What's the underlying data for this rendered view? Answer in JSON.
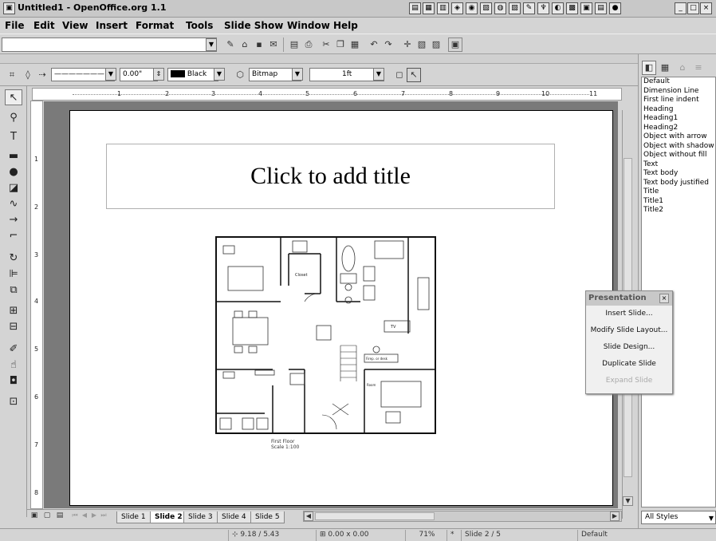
{
  "window": {
    "title": "Untitled1 - OpenOffice.org 1.1"
  },
  "menu": {
    "items": [
      "File",
      "Edit",
      "View",
      "Insert",
      "Format",
      "Tools",
      "Slide Show",
      "Window",
      "Help"
    ]
  },
  "object_bar": {
    "line_width": "0.00\"",
    "line_color": "Black",
    "area_style": "Bitmap",
    "area_fill": "1ft"
  },
  "ruler": {
    "h_numbers": [
      "1",
      "2",
      "3",
      "4",
      "5",
      "6",
      "7",
      "8",
      "9",
      "10",
      "11"
    ],
    "v_numbers": [
      "1",
      "2",
      "3",
      "4",
      "5",
      "6",
      "7",
      "8"
    ]
  },
  "slide": {
    "title_placeholder": "Click to add title",
    "plan_labels": {
      "closet": "Closet",
      "tv": "TV",
      "fireplace": "Firep. or desk",
      "room": "Room",
      "caption": "First Floor\nScale 1:100"
    }
  },
  "presentation_popup": {
    "title": "Presentation",
    "items": [
      {
        "label": "Insert Slide...",
        "enabled": true
      },
      {
        "label": "Modify Slide Layout...",
        "enabled": true
      },
      {
        "label": "Slide Design...",
        "enabled": true
      },
      {
        "label": "Duplicate Slide",
        "enabled": true
      },
      {
        "label": "Expand Slide",
        "enabled": false
      }
    ]
  },
  "stylist": {
    "styles": [
      "Default",
      "Dimension Line",
      "First line indent",
      "Heading",
      "Heading1",
      "Heading2",
      "Object with arrow",
      "Object with shadow",
      "Object without fill",
      "Text",
      "Text body",
      "Text body justified",
      "Title",
      "Title1",
      "Title2"
    ],
    "filter": "All Styles"
  },
  "tabs": [
    {
      "label": "Slide 1",
      "active": false
    },
    {
      "label": "Slide 2",
      "active": true
    },
    {
      "label": "Slide 3",
      "active": false
    },
    {
      "label": "Slide 4",
      "active": false
    },
    {
      "label": "Slide 5",
      "active": false
    }
  ],
  "status": {
    "position": "9.18 / 5.43",
    "size": "0.00 x 0.00",
    "zoom": "71%",
    "slide": "Slide 2 / 5",
    "layout": "Default"
  }
}
